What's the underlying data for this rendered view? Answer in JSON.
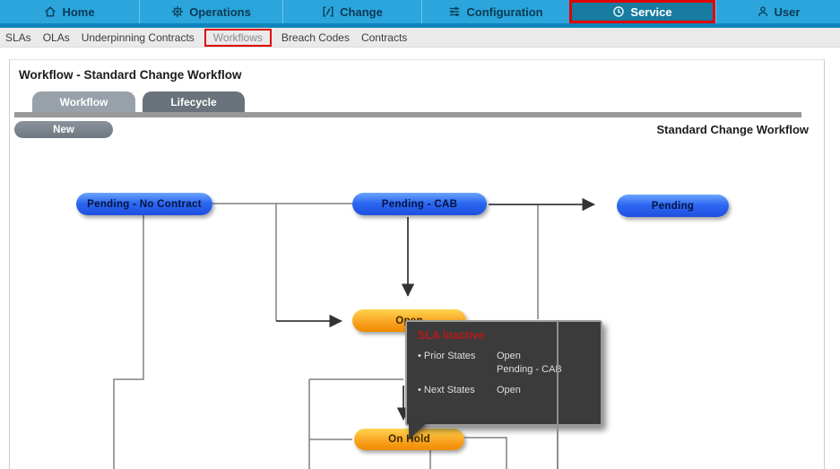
{
  "nav": {
    "items": [
      {
        "label": "Home",
        "icon": "home-icon"
      },
      {
        "label": "Operations",
        "icon": "operations-icon"
      },
      {
        "label": "Change",
        "icon": "change-icon"
      },
      {
        "label": "Configuration",
        "icon": "configuration-icon"
      },
      {
        "label": "Service",
        "icon": "service-icon",
        "selected": true
      },
      {
        "label": "User",
        "icon": "user-icon"
      }
    ],
    "colors": {
      "bar": "#2BA5DB",
      "selected_bg": "#177C9F",
      "highlight_border": "#E10000",
      "strip": "#0F85BB",
      "text": "#0A3A55"
    }
  },
  "submenu": {
    "items": [
      {
        "label": "SLAs"
      },
      {
        "label": "OLAs"
      },
      {
        "label": "Underpinning Contracts"
      },
      {
        "label": "Workflows",
        "highlighted": true
      },
      {
        "label": "Breach Codes"
      },
      {
        "label": "Contracts"
      }
    ]
  },
  "page": {
    "title": "Workflow - Standard Change Workflow",
    "tabs": [
      {
        "label": "Workflow",
        "active": true
      },
      {
        "label": "Lifecycle",
        "active": false
      }
    ],
    "new_button_label": "New",
    "workflow_name": "Standard Change Workflow"
  },
  "diagram": {
    "nodes": [
      {
        "id": "pending-no-contract",
        "label": "Pending - No Contract",
        "type": "blue"
      },
      {
        "id": "pending-cab",
        "label": "Pending - CAB",
        "type": "blue"
      },
      {
        "id": "pending",
        "label": "Pending",
        "type": "blue"
      },
      {
        "id": "open",
        "label": "Open",
        "type": "orange"
      },
      {
        "id": "on-hold",
        "label": "On Hold",
        "type": "orange"
      }
    ],
    "colors": {
      "blue_node": "#2B66F0",
      "orange_node": "#F9A01E",
      "line": "#808080",
      "arrow": "#333333"
    }
  },
  "tooltip": {
    "title": "SLA Inactive",
    "title_color": "#B51A1A",
    "bullet": "•",
    "rows": [
      {
        "label": "Prior States",
        "values": "Open\nPending - CAB"
      },
      {
        "label": "Next States",
        "values": "Open"
      }
    ]
  }
}
